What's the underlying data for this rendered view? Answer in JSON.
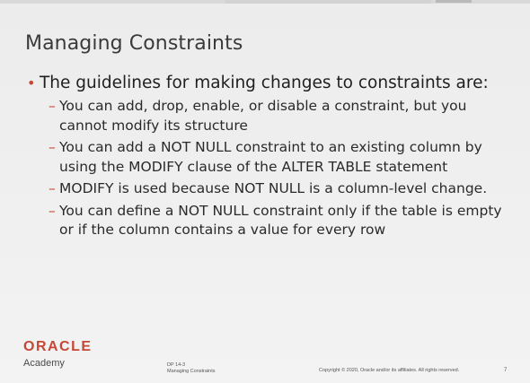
{
  "slide": {
    "title": "Managing Constraints",
    "bullet": {
      "marker": "•",
      "text": "The guidelines for making changes to constraints are:",
      "sub_marker": "–",
      "items": [
        "You can add, drop, enable, or disable a constraint, but you cannot modify its structure",
        "You can add a NOT NULL constraint to an existing column by using the MODIFY clause of the ALTER TABLE statement",
        "MODIFY is used because NOT NULL is a column-level change.",
        "You can define a NOT NULL constraint only if the table is empty or if the column contains a value for every row"
      ]
    }
  },
  "footer": {
    "brand": "ORACLE",
    "sub_brand": "Academy",
    "course_code": "DP 14-3",
    "course_title": "Managing Constraints",
    "copyright": "Copyright © 2020, Oracle and/or its affiliates. All rights reserved.",
    "page_number": "7"
  },
  "colors": {
    "accent": "#c74634",
    "title_text": "#3a3a3a",
    "body_text": "#1f1f1f",
    "background": "#efefef"
  }
}
